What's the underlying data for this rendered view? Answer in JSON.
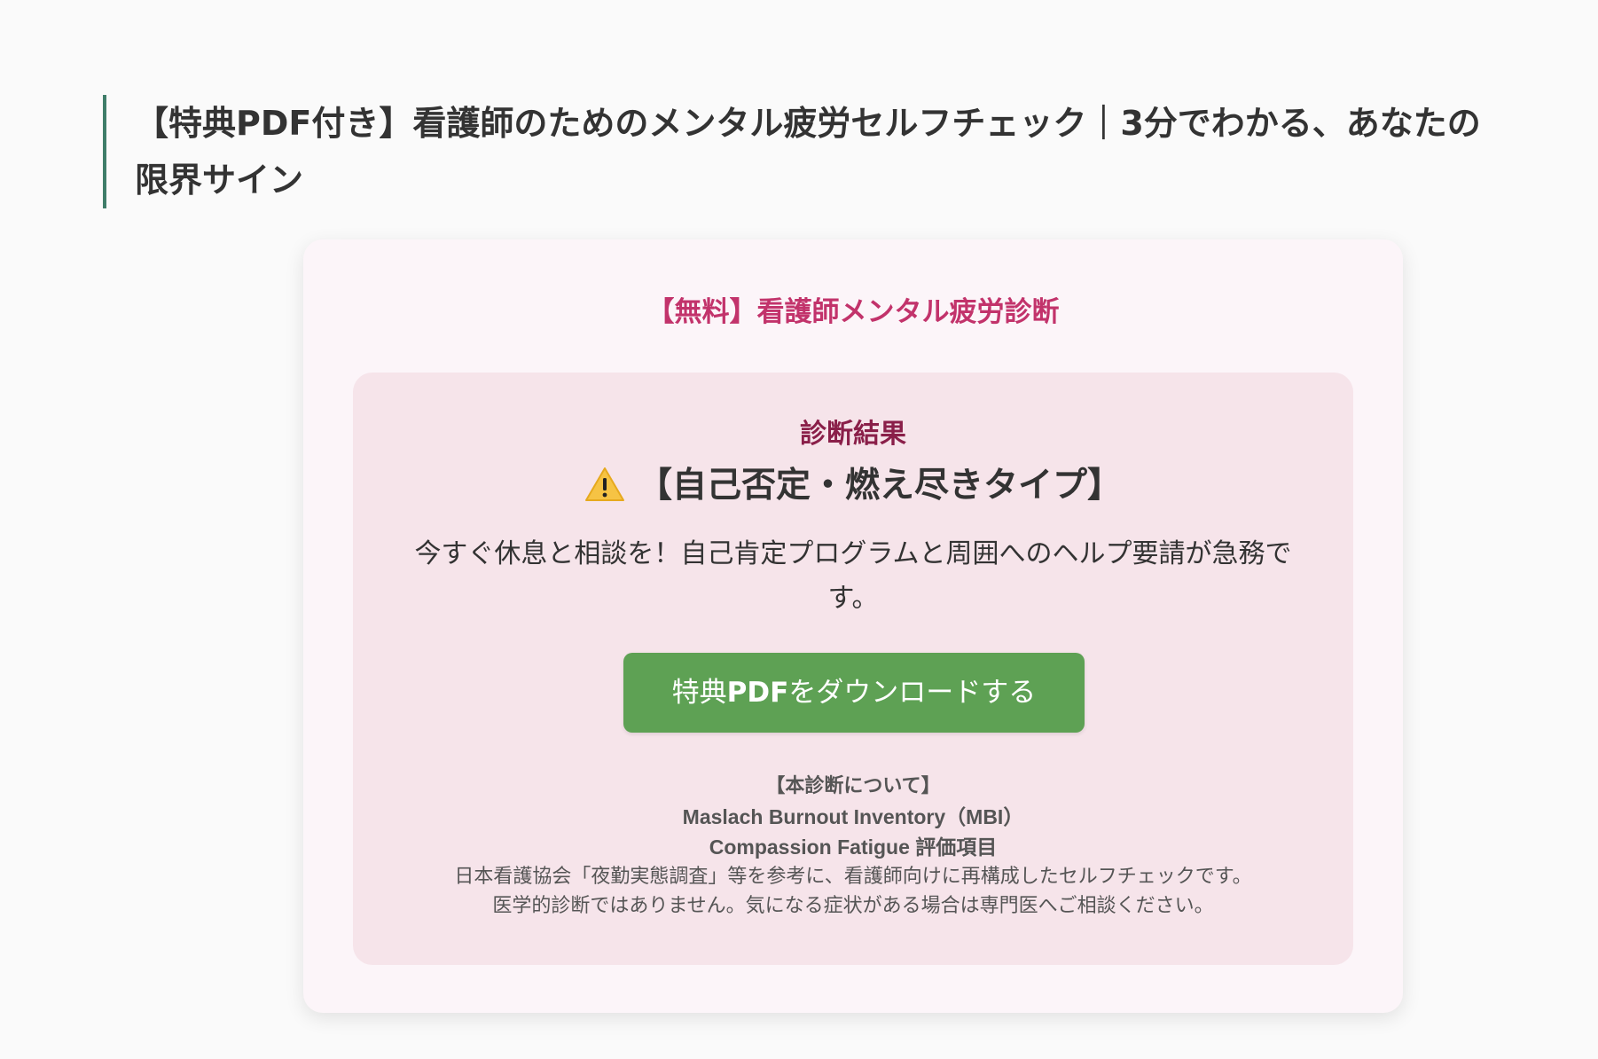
{
  "page": {
    "title_line1": "【特典PDF付き】看護師のためのメンタル疲労セルフチェック｜3分でわかる、あなたの",
    "title_line2": "限界サイン",
    "accent_color": "#3f7d69"
  },
  "quiz": {
    "title": "【無料】看護師メンタル疲労診断",
    "title_color": "#c2336b",
    "result": {
      "heading": "診断結果",
      "icon": "warning-icon",
      "type_label": "【自己否定・燃え尽きタイプ】",
      "message": "今すぐ休息と相談を！自己肯定プログラムと周囲へのヘルプ要請が急務です。"
    },
    "download_button": {
      "label_prefix": "特典",
      "label_strong": "PDF",
      "label_suffix": "をダウンロードする",
      "color": "#5ea154"
    },
    "about": {
      "title": "【本診断について】",
      "sources": [
        "Maslach Burnout Inventory（MBI）",
        "Compassion Fatigue 評価項目"
      ],
      "lines": [
        "日本看護協会「夜勤実態調査」等を参考に、看護師向けに再構成したセルフチェックです。",
        "医学的診断ではありません。気になる症状がある場合は専門医へご相談ください。"
      ]
    }
  }
}
